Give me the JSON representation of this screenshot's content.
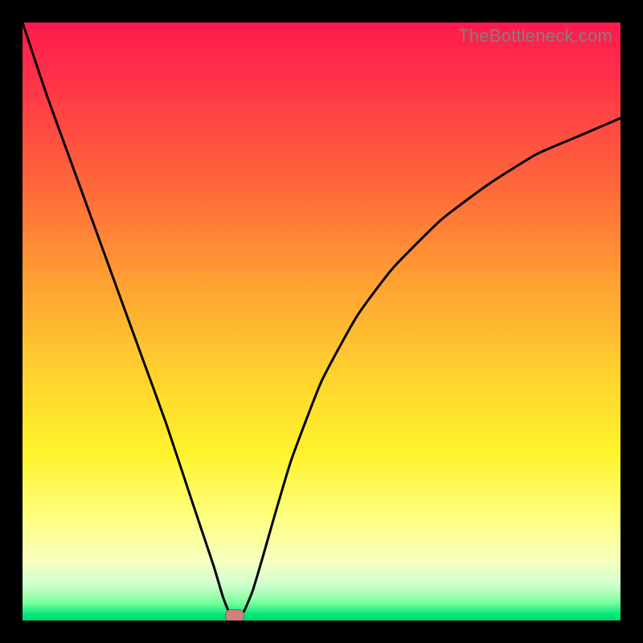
{
  "watermark": "TheBottleneck.com",
  "dot": {
    "x_frac": 0.355,
    "y_frac": 0.992
  },
  "chart_data": {
    "type": "line",
    "title": "",
    "xlabel": "",
    "ylabel": "",
    "xlim": [
      0,
      1
    ],
    "ylim": [
      0,
      1
    ],
    "grid": false,
    "legend": false,
    "background": "rainbow-gradient red(top) → green(bottom)",
    "series": [
      {
        "name": "bottleneck-curve",
        "x": [
          0.0,
          0.04,
          0.08,
          0.12,
          0.16,
          0.2,
          0.24,
          0.28,
          0.3,
          0.32,
          0.335,
          0.345,
          0.355,
          0.37,
          0.385,
          0.4,
          0.42,
          0.45,
          0.5,
          0.56,
          0.62,
          0.7,
          0.78,
          0.86,
          0.93,
          1.0
        ],
        "y": [
          1.0,
          0.88,
          0.77,
          0.66,
          0.55,
          0.44,
          0.33,
          0.21,
          0.15,
          0.09,
          0.04,
          0.015,
          0.005,
          0.015,
          0.05,
          0.1,
          0.17,
          0.27,
          0.4,
          0.51,
          0.59,
          0.67,
          0.73,
          0.78,
          0.81,
          0.84
        ]
      }
    ],
    "markers": [
      {
        "name": "optimal-point",
        "x": 0.355,
        "y": 0.008,
        "shape": "pill",
        "color": "#d08080"
      }
    ]
  }
}
